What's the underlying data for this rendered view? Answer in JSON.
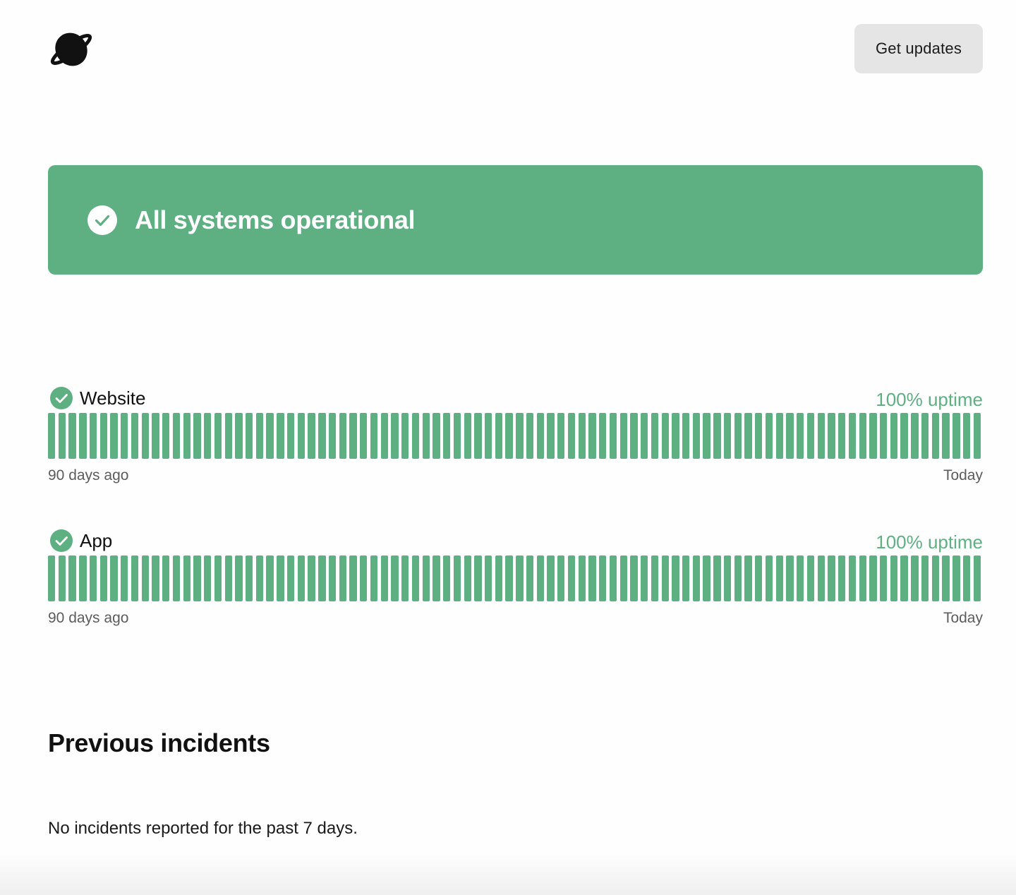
{
  "header": {
    "logo_icon": "planet-icon",
    "get_updates_label": "Get updates"
  },
  "banner": {
    "icon": "check-circle-icon",
    "text": "All systems operational",
    "color": "#5eb083"
  },
  "services": [
    {
      "name": "Website",
      "uptime_text": "100% uptime",
      "bar_count": 90,
      "bar_status": "operational",
      "range_start": "90 days ago",
      "range_end": "Today"
    },
    {
      "name": "App",
      "uptime_text": "100% uptime",
      "bar_count": 90,
      "bar_status": "operational",
      "range_start": "90 days ago",
      "range_end": "Today"
    }
  ],
  "incidents": {
    "title": "Previous incidents",
    "empty_text": "No incidents reported for the past 7 days."
  },
  "colors": {
    "operational": "#5eb083",
    "button_bg": "#e5e5e5"
  }
}
